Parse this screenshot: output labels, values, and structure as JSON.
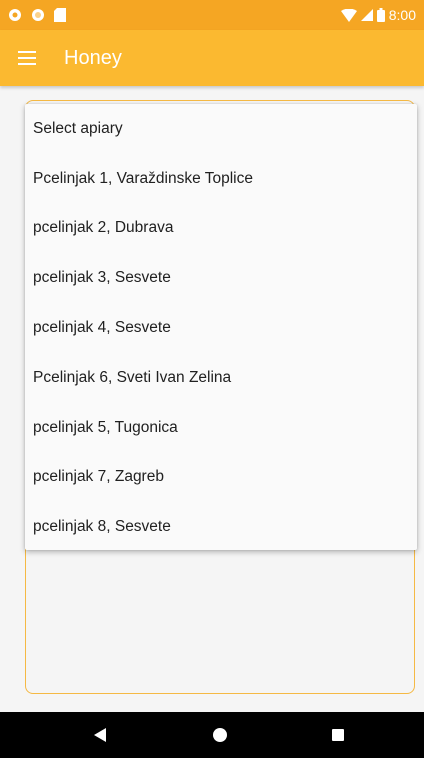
{
  "status_bar": {
    "time": "8:00",
    "icons": [
      "app-notification-icon",
      "app-notification-icon",
      "sd-card-icon",
      "wifi-icon",
      "signal-icon",
      "battery-icon"
    ]
  },
  "app_bar": {
    "title": "Honey",
    "menu_icon": "hamburger-menu-icon"
  },
  "dropdown": {
    "items": [
      {
        "label": "Select apiary"
      },
      {
        "label": "Pcelinjak 1, Varaždinske Toplice"
      },
      {
        "label": "pcelinjak 2, Dubrava"
      },
      {
        "label": "pcelinjak 3, Sesvete"
      },
      {
        "label": "pcelinjak 4, Sesvete"
      },
      {
        "label": "Pcelinjak 6, Sveti Ivan Zelina"
      },
      {
        "label": "pcelinjak 5, Tugonica"
      },
      {
        "label": "pcelinjak 7, Zagreb"
      },
      {
        "label": "pcelinjak 8, Sesvete"
      }
    ]
  },
  "colors": {
    "status_bar": "#f5a623",
    "app_bar": "#fbb930",
    "card_border": "#f5b944",
    "nav_bar": "#000000"
  },
  "nav_bar": {
    "icons": [
      "back-icon",
      "home-icon",
      "recent-apps-icon"
    ]
  }
}
